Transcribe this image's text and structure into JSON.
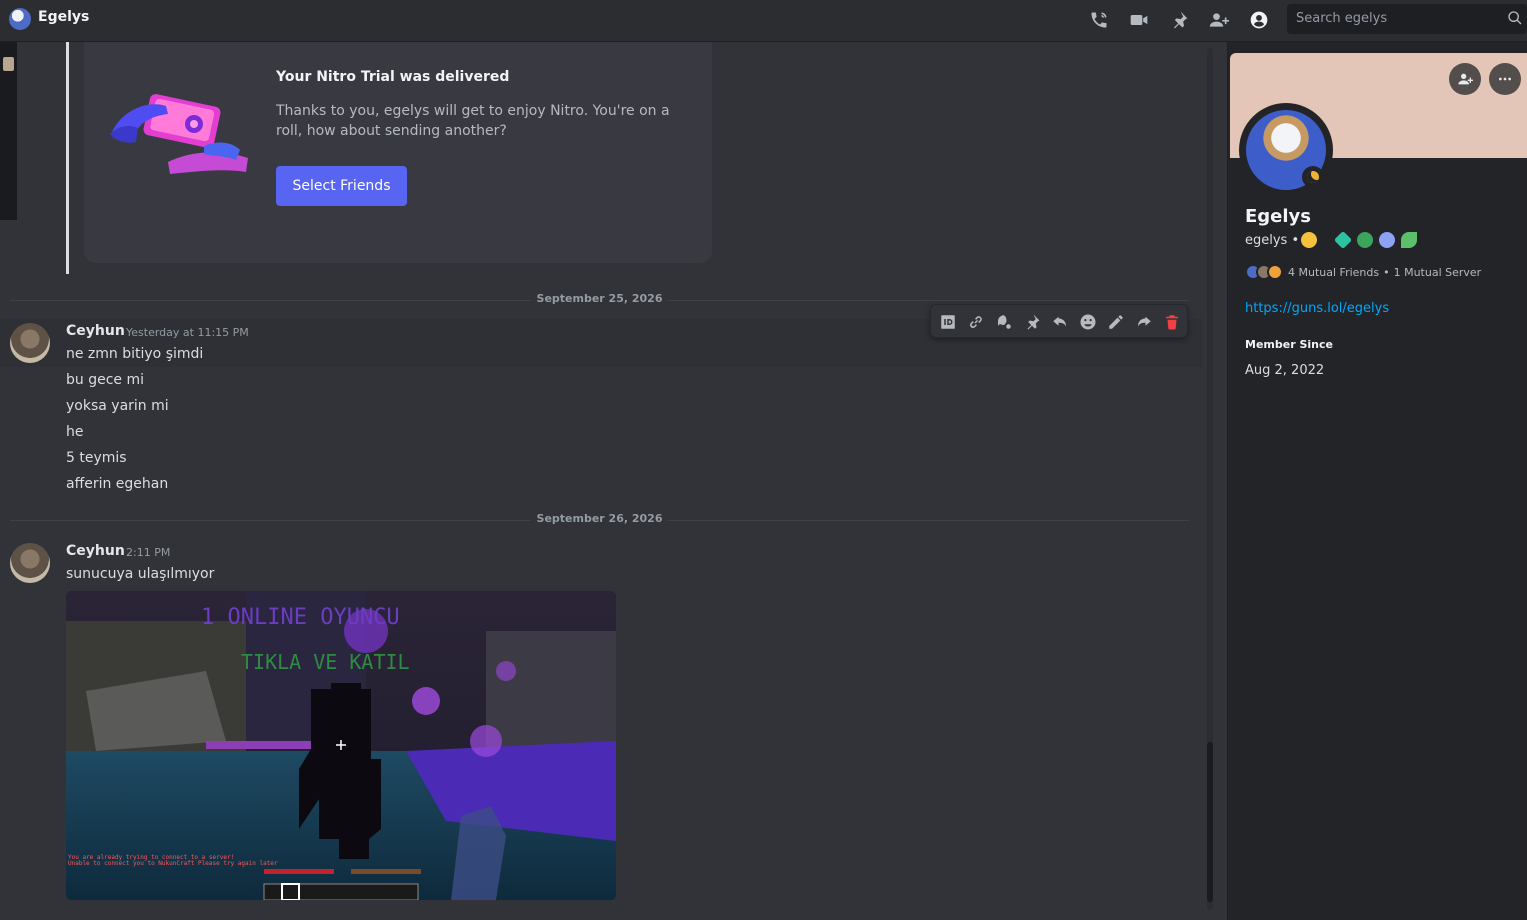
{
  "header": {
    "channel_title": "Egelys",
    "search_placeholder": "Search egelys",
    "icons": [
      "voice-call-icon",
      "video-call-icon",
      "pinned-messages-icon",
      "add-friends-to-dm-icon",
      "user-profile-icon",
      "search-icon"
    ]
  },
  "gift": {
    "title": "Your Nitro Trial was delivered",
    "description": "Thanks to you, egelys will get to enjoy Nitro. You're on a roll, how about sending another?",
    "button_label": "Select Friends"
  },
  "dividers": {
    "first": "September 25, 2026",
    "second": "September 26, 2026"
  },
  "messages": {
    "first": {
      "author": "Ceyhun",
      "timestamp": "Yesterday at 11:15 PM",
      "lines": [
        "ne zmn bitiyo şimdi",
        "bu gece mi",
        "yoksa yarin mi",
        "he",
        "5 teymis",
        "afferin egehan"
      ]
    },
    "second": {
      "author": "Ceyhun",
      "timestamp": "2:11 PM",
      "lines": [
        "sunucuya ulaşılmıyor"
      ],
      "image_text": {
        "line1": "1 ONLINE OYUNCU",
        "line2": "TIKLA VE KATIL",
        "chat1": "You are already trying to connect to a server!",
        "chat2": "Unable to connect you to NukunCraft Please try again later"
      }
    }
  },
  "toolbar_icons": [
    "copy-id-icon",
    "copy-link-icon",
    "mention-reply-icon",
    "pin-icon",
    "reply-icon",
    "add-reaction-icon",
    "edit-icon",
    "forward-icon",
    "delete-icon"
  ],
  "profile": {
    "display_name": "Egelys",
    "username": "egelys",
    "separator": "•",
    "mutual_friends": "4 Mutual Friends",
    "mutual_separator": "•",
    "mutual_servers": "1 Mutual Server",
    "link": "https://guns.lol/egelys",
    "member_since_label": "Member Since",
    "member_since_value": "Aug 2, 2022",
    "banner_color": "#e3c6b8",
    "status": "idle"
  },
  "colors": {
    "accent": "#5865f2",
    "link": "#00a8fc",
    "danger": "#f23f43",
    "idle": "#f0b232"
  }
}
